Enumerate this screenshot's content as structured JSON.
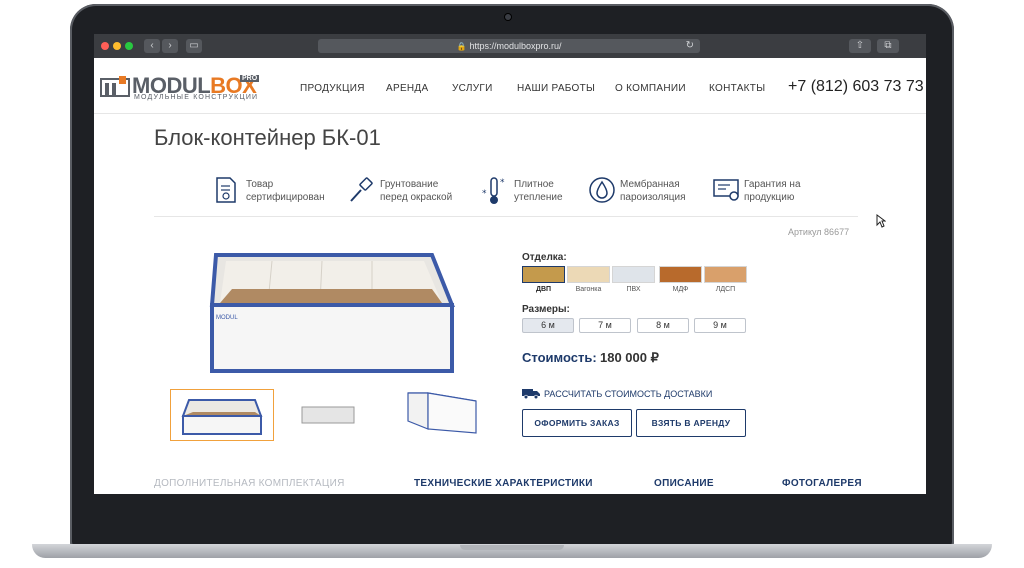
{
  "browser": {
    "url": "https://modulboxpro.ru/"
  },
  "header": {
    "logo": {
      "word_main": "MODUL",
      "word_accent": "BOX",
      "badge": "PRO",
      "subtitle": "МОДУЛЬНЫЕ КОНСТРУКЦИИ"
    },
    "menu": [
      "ПРОДУКЦИЯ",
      "АРЕНДА",
      "УСЛУГИ",
      "НАШИ РАБОТЫ",
      "О КОМПАНИИ",
      "КОНТАКТЫ"
    ],
    "phone": "+7 (812) 603 73 73"
  },
  "product": {
    "title": "Блок-контейнер БК-01",
    "features": [
      {
        "icon": "certificate-icon",
        "line1": "Товар",
        "line2": "сертифицирован"
      },
      {
        "icon": "paint-brush-icon",
        "line1": "Грунтование",
        "line2": "перед окраской"
      },
      {
        "icon": "thermometer-icon",
        "line1": "Плитное",
        "line2": "утепление"
      },
      {
        "icon": "water-drop-icon",
        "line1": "Мембранная",
        "line2": "пароизоляция"
      },
      {
        "icon": "warranty-icon",
        "line1": "Гарантия на",
        "line2": "продукцию"
      }
    ],
    "article": "Артикул 86677",
    "finish_label": "Отделка:",
    "finishes": [
      {
        "name": "ДВП",
        "color": "#c49a4c",
        "selected": true
      },
      {
        "name": "Вагонка",
        "color": "#ecd9b6",
        "selected": false
      },
      {
        "name": "ПВХ",
        "color": "#dfe4ea",
        "selected": false
      },
      {
        "name": "МДФ",
        "color": "#b86a2c",
        "selected": false
      },
      {
        "name": "ЛДСП",
        "color": "#d9a06b",
        "selected": false
      }
    ],
    "sizes_label": "Размеры:",
    "sizes": [
      "6 м",
      "7 м",
      "8 м",
      "9 м"
    ],
    "selected_size": "6 м",
    "price_label": "Стоимость:",
    "price_value": "180 000 ₽",
    "delivery_link": "РАССЧИТАТЬ СТОИМОСТЬ ДОСТАВКИ",
    "order_button": "ОФОРМИТЬ ЗАКАЗ",
    "rent_button": "ВЗЯТЬ В АРЕНДУ"
  },
  "tabs": [
    {
      "label": "ДОПОЛНИТЕЛЬНАЯ КОМПЛЕКТАЦИЯ",
      "active": false
    },
    {
      "label": "ТЕХНИЧЕСКИЕ ХАРАКТЕРИСТИКИ",
      "active": true
    },
    {
      "label": "ОПИСАНИЕ",
      "active": true
    },
    {
      "label": "ФОТОГАЛЕРЕЯ",
      "active": true
    }
  ],
  "colors": {
    "accent": "#1e3a6a",
    "brand_orange": "#e87a24",
    "thumb_active_border": "#f1a13c",
    "container_frame": "#3c5aa8"
  }
}
